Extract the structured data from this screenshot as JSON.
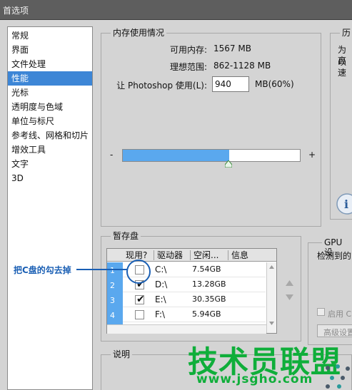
{
  "window": {
    "title": "首选项"
  },
  "sidebar": {
    "items": [
      {
        "label": "常规",
        "selected": false
      },
      {
        "label": "界面",
        "selected": false
      },
      {
        "label": "文件处理",
        "selected": false
      },
      {
        "label": "性能",
        "selected": true
      },
      {
        "label": "光标",
        "selected": false
      },
      {
        "label": "透明度与色域",
        "selected": false
      },
      {
        "label": "单位与标尺",
        "selected": false
      },
      {
        "label": "参考线、网格和切片",
        "selected": false
      },
      {
        "label": "增效工具",
        "selected": false
      },
      {
        "label": "文字",
        "selected": false
      },
      {
        "label": "3D",
        "selected": false
      }
    ]
  },
  "memory": {
    "group_title": "内存使用情况",
    "available_label": "可用内存:",
    "available_value": "1567 MB",
    "ideal_label": "理想范围:",
    "ideal_value": "862-1128 MB",
    "let_label": "让 Photoshop 使用(L):",
    "let_value": "940",
    "let_unit": "MB(60%)",
    "slider_minus": "-",
    "slider_plus": "+",
    "slider_fraction": 0.6
  },
  "history": {
    "group_title": "历",
    "line1": "为以",
    "line2": "高速"
  },
  "scratch": {
    "group_title": "暂存盘",
    "columns": [
      "现用?",
      "驱动器",
      "空闲...",
      "信息"
    ],
    "rows": [
      {
        "num": "1",
        "checked": false,
        "drive": "C:\\",
        "free": "7.54GB"
      },
      {
        "num": "2",
        "checked": true,
        "drive": "D:\\",
        "free": "13.28GB"
      },
      {
        "num": "3",
        "checked": true,
        "drive": "E:\\",
        "free": "30.35GB"
      },
      {
        "num": "4",
        "checked": false,
        "drive": "F:\\",
        "free": "5.94GB"
      }
    ]
  },
  "gpu": {
    "group_title": "GPU 设",
    "detected": "检测到的",
    "enable_label": "启用 C",
    "advanced_label": "高级设置"
  },
  "description": {
    "group_title": "说明"
  },
  "annotation": {
    "text": "把C盘的勾去掉"
  },
  "watermark": {
    "text": "技术员联盟",
    "url": "www.jsgho.com"
  },
  "colors": {
    "accent": "#3d86d6",
    "annotation": "#1a5fb4",
    "watermark": "#0fae3a",
    "fill": "#5aa8ee"
  },
  "icons": [
    "info-icon",
    "up-arrow-icon",
    "down-arrow-icon"
  ]
}
